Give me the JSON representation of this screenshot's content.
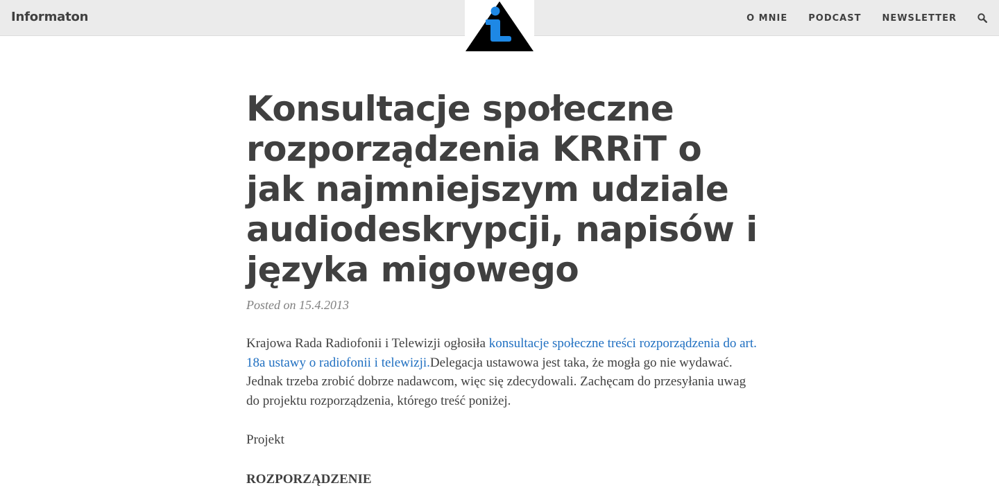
{
  "site": {
    "brand": "Informaton"
  },
  "nav": {
    "items": [
      {
        "label": "O MNIE"
      },
      {
        "label": "PODCAST"
      },
      {
        "label": "NEWSLETTER"
      }
    ],
    "search_icon": "search-icon"
  },
  "logo": {
    "icon": "info-triangle-logo",
    "colors": {
      "triangle": "#000000",
      "glyph": "#1e88e5"
    }
  },
  "post": {
    "title": "Konsultacje społeczne rozporządzenia KRRiT o jak najmniejszym udziale audiodeskrypcji, napisów i języka migowego",
    "meta_prefix": "Posted on",
    "date": "15.4.2013",
    "paragraphs": {
      "p1_before": "Krajowa Rada Radiofonii i Telewizji ogłosiła ",
      "p1_link": "konsultacje społeczne treści rozporządzenia do art. 18a ustawy o radiofonii i telewizji.",
      "p1_after": "Delegacja ustawowa jest taka, że mogła go nie wydawać. Jednak trzeba zrobić dobrze nadawcom, więc się zdecydowali. Zachęcam do przesyłania uwag do projektu rozporządzenia, którego treść poniżej.",
      "p2": "Projekt",
      "p3": "ROZPORZĄDZENIE"
    }
  },
  "colors": {
    "header_bg": "#ebebeb",
    "text": "#404040",
    "link": "#1f6fc1",
    "meta": "#808080"
  }
}
